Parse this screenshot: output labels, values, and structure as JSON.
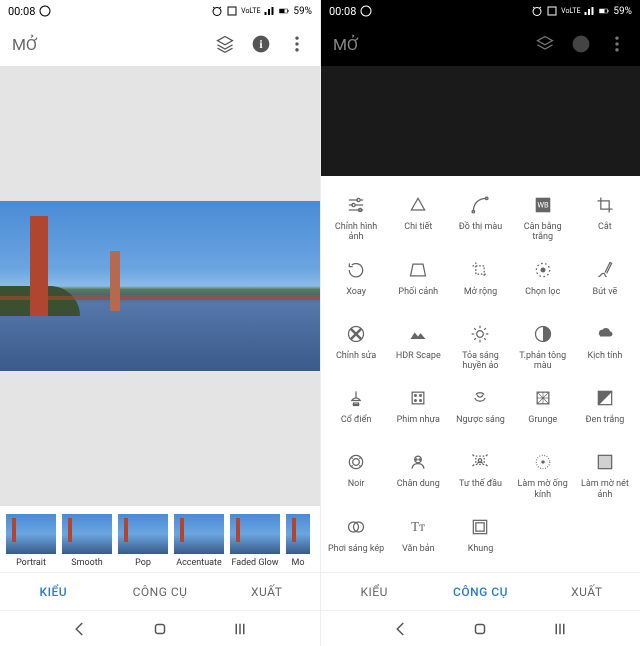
{
  "statusbar": {
    "time": "00:08",
    "battery": "59%",
    "signal": "VoLTE"
  },
  "topbar": {
    "title": "MỞ"
  },
  "filters": [
    {
      "label": "Portrait"
    },
    {
      "label": "Smooth"
    },
    {
      "label": "Pop"
    },
    {
      "label": "Accentuate"
    },
    {
      "label": "Faded Glow"
    },
    {
      "label": "Mo"
    }
  ],
  "tabs": {
    "kieu": "KIỂU",
    "congcu": "CÔNG CỤ",
    "xuat": "XUẤT"
  },
  "tools": [
    {
      "icon": "sliders",
      "label": "Chỉnh hình ảnh"
    },
    {
      "icon": "chi-tiet",
      "label": "Chi tiết"
    },
    {
      "icon": "curve",
      "label": "Đồ thị màu"
    },
    {
      "icon": "wb",
      "label": "Cân bằng trắng"
    },
    {
      "icon": "crop",
      "label": "Cắt"
    },
    {
      "icon": "rotate",
      "label": "Xoay"
    },
    {
      "icon": "perspective",
      "label": "Phối cảnh"
    },
    {
      "icon": "expand",
      "label": "Mở rộng"
    },
    {
      "icon": "select",
      "label": "Chọn lọc"
    },
    {
      "icon": "brush",
      "label": "Bút vẽ"
    },
    {
      "icon": "heal",
      "label": "Chỉnh sửa"
    },
    {
      "icon": "hdr",
      "label": "HDR Scape"
    },
    {
      "icon": "glow",
      "label": "Tỏa sáng huyền ảo"
    },
    {
      "icon": "tonal",
      "label": "T.phản tông màu"
    },
    {
      "icon": "drama",
      "label": "Kịch tính"
    },
    {
      "icon": "vintage",
      "label": "Cổ điển"
    },
    {
      "icon": "film",
      "label": "Phim nhựa"
    },
    {
      "icon": "retrolux",
      "label": "Ngược sáng"
    },
    {
      "icon": "grunge",
      "label": "Grunge"
    },
    {
      "icon": "bw",
      "label": "Đen trắng"
    },
    {
      "icon": "noir",
      "label": "Noir"
    },
    {
      "icon": "portrait",
      "label": "Chân dung"
    },
    {
      "icon": "headpose",
      "label": "Tư thế đầu"
    },
    {
      "icon": "lensblur",
      "label": "Làm mờ ống kính"
    },
    {
      "icon": "vignette",
      "label": "Làm mờ nét ảnh"
    },
    {
      "icon": "double",
      "label": "Phơi sáng kép"
    },
    {
      "icon": "text",
      "label": "Văn bản"
    },
    {
      "icon": "frame",
      "label": "Khung"
    }
  ]
}
